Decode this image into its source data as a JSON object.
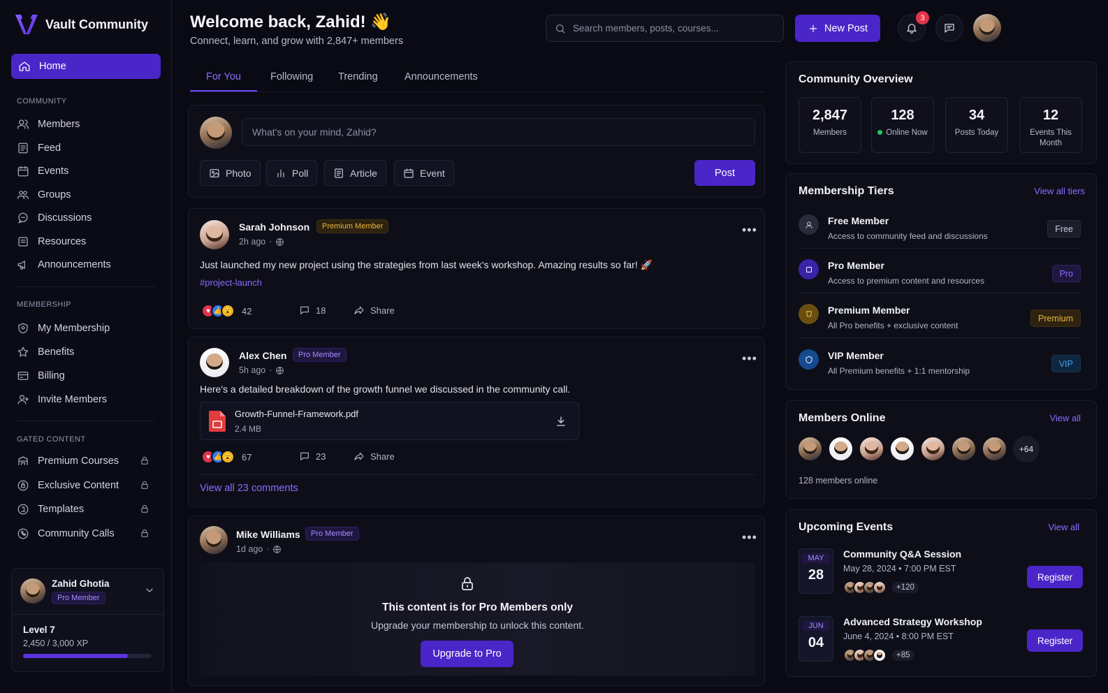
{
  "brand": {
    "name": "Vault Community"
  },
  "sidebar": {
    "home": "Home",
    "community_heading": "COMMUNITY",
    "community_items": [
      {
        "label": "Members"
      },
      {
        "label": "Feed"
      },
      {
        "label": "Events"
      },
      {
        "label": "Groups"
      },
      {
        "label": "Discussions"
      },
      {
        "label": "Resources"
      },
      {
        "label": "Announcements"
      }
    ],
    "membership_heading": "MEMBERSHIP",
    "membership_items": [
      {
        "label": "My Membership"
      },
      {
        "label": "Benefits"
      },
      {
        "label": "Billing"
      },
      {
        "label": "Invite Members"
      }
    ],
    "gated_heading": "GATED CONTENT",
    "gated_items": [
      {
        "label": "Premium Courses"
      },
      {
        "label": "Exclusive Content"
      },
      {
        "label": "Templates"
      },
      {
        "label": "Community Calls"
      }
    ],
    "user": {
      "name": "Zahid Ghotia",
      "tier": "Pro Member",
      "level": "Level 7",
      "xp": "2,450 / 3,000 XP",
      "progress": 0.817
    }
  },
  "header": {
    "welcome": "Welcome back, Zahid! 👋",
    "subtitle": "Connect, learn, and grow with 2,847+ members",
    "search_placeholder": "Search members, posts, courses...",
    "new_post": "New Post",
    "notif_count": "3"
  },
  "tabs": [
    {
      "label": "For You"
    },
    {
      "label": "Following"
    },
    {
      "label": "Trending"
    },
    {
      "label": "Announcements"
    }
  ],
  "composer": {
    "placeholder": "What's on your mind, Zahid?",
    "photo": "Photo",
    "poll": "Poll",
    "article": "Article",
    "event": "Event",
    "post": "Post"
  },
  "posts": [
    {
      "name": "Sarah Johnson",
      "tier": "Premium Member",
      "time": "2h ago",
      "text": "Just launched my new project using the strategies from last week's workshop. Amazing results so far! 🚀",
      "hashtag": "#project-launch",
      "reactions": "42",
      "comments": "18",
      "share": "Share"
    },
    {
      "name": "Alex Chen",
      "tier": "Pro Member",
      "time": "5h ago",
      "text": "Here's a detailed breakdown of the growth funnel we discussed in the community call.",
      "file_name": "Growth-Funnel-Framework.pdf",
      "file_size": "2.4 MB",
      "reactions": "67",
      "comments": "23",
      "share": "Share",
      "view_comments": "View all 23 comments"
    },
    {
      "name": "Mike Williams",
      "tier": "Pro Member",
      "time": "1d ago",
      "locked_title": "This content is for Pro Members only",
      "locked_sub": "Upgrade your membership to unlock this content.",
      "upgrade": "Upgrade to Pro"
    }
  ],
  "overview": {
    "title": "Community Overview",
    "stats": [
      {
        "value": "2,847",
        "label": "Members"
      },
      {
        "value": "128",
        "label": "Online Now"
      },
      {
        "value": "34",
        "label": "Posts Today"
      },
      {
        "value": "12",
        "label": "Events This Month"
      }
    ]
  },
  "tiers": {
    "title": "Membership Tiers",
    "view_all": "View all tiers",
    "items": [
      {
        "name": "Free Member",
        "desc": "Access to community feed and discussions",
        "badge": "Free",
        "color": "#9a9ab0"
      },
      {
        "name": "Pro Member",
        "desc": "Access to premium content and resources",
        "badge": "Pro",
        "color": "#7c5cff"
      },
      {
        "name": "Premium Member",
        "desc": "All Pro benefits + exclusive content",
        "badge": "Premium",
        "color": "#e0a82e"
      },
      {
        "name": "VIP Member",
        "desc": "All Premium benefits + 1:1 mentorship",
        "badge": "VIP",
        "color": "#3b82f6"
      }
    ]
  },
  "online": {
    "title": "Members Online",
    "view_all": "View all",
    "more": "+64",
    "caption": "128 members online"
  },
  "events": {
    "title": "Upcoming Events",
    "view_all": "View all",
    "items": [
      {
        "month": "MAY",
        "day": "28",
        "title": "Community Q&A Session",
        "date": "May 28, 2024 • 7:00 PM EST",
        "attendees": "+120",
        "register": "Register"
      },
      {
        "month": "JUN",
        "day": "04",
        "title": "Advanced Strategy Workshop",
        "date": "June 4, 2024 • 8:00 PM EST",
        "attendees": "+85",
        "register": "Register"
      }
    ]
  }
}
